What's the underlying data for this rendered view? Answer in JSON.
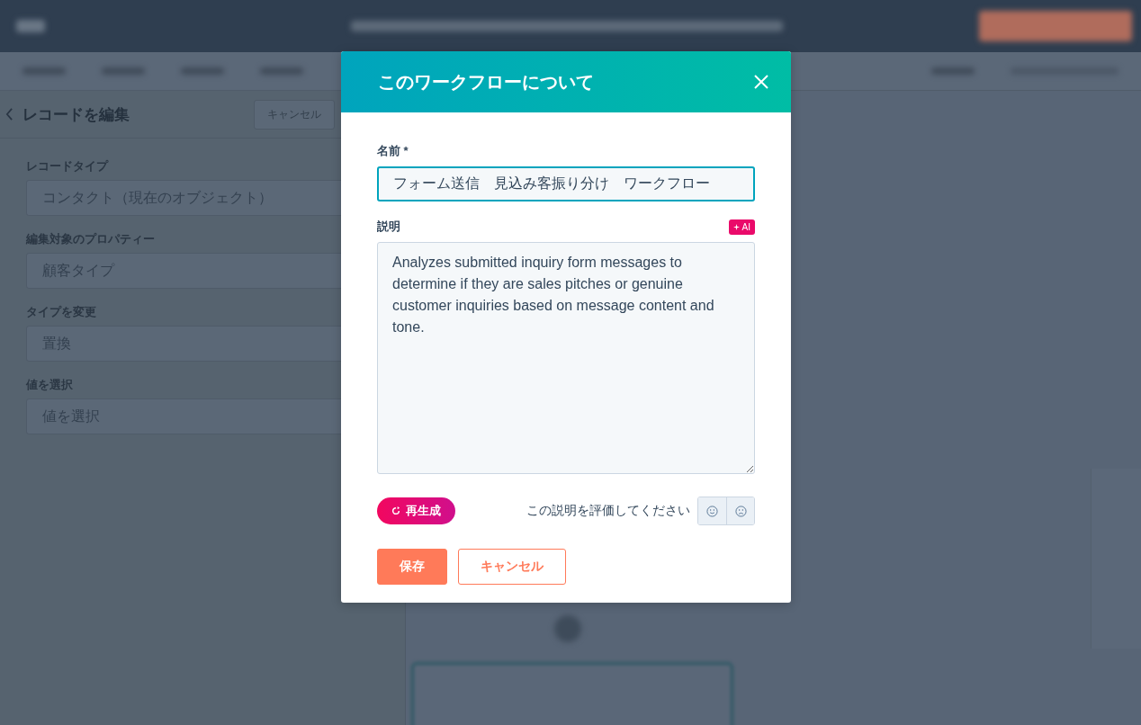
{
  "editor_panel": {
    "back_label": "レコードを編集",
    "cancel_button": "キャンセル",
    "fields": [
      {
        "label": "レコードタイプ",
        "value": "コンタクト（現在のオブジェクト）"
      },
      {
        "label": "編集対象のプロパティー",
        "value": "顧客タイプ"
      },
      {
        "label": "タイプを変更",
        "value": "置換"
      },
      {
        "label": "値を選択",
        "placeholder": "値を選択"
      }
    ]
  },
  "modal": {
    "title": "このワークフローについて",
    "name_label": "名前 *",
    "name_value": "フォーム送信　見込み客振り分け　ワークフロー",
    "description_label": "説明",
    "ai_badge": "AI",
    "description_value": "Analyzes submitted inquiry form messages to determine if they are sales pitches or genuine customer inquiries based on message content and tone.",
    "regenerate_button": "再生成",
    "rating_prompt": "この説明を評価してください",
    "save_button": "保存",
    "cancel_button": "キャンセル"
  }
}
